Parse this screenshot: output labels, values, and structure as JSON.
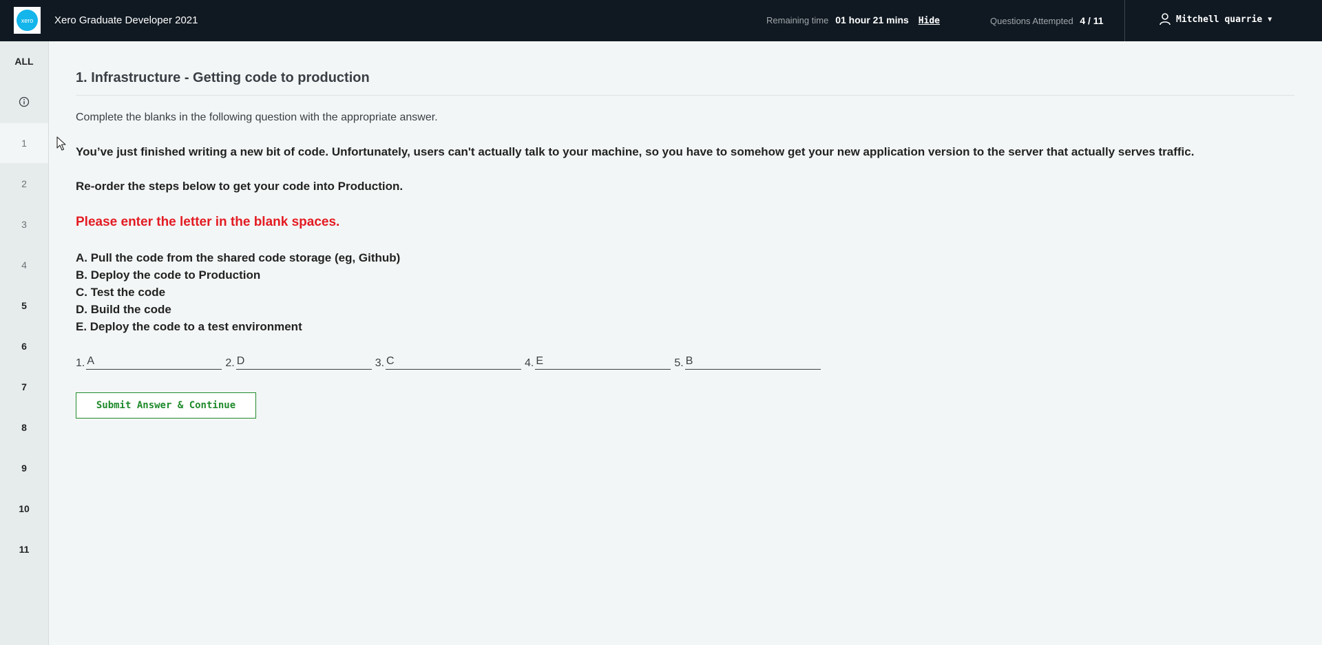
{
  "header": {
    "logo_text": "xero",
    "app_title": "Xero Graduate Developer 2021",
    "remaining_label": "Remaining time",
    "remaining_value": "01 hour 21 mins",
    "hide_label": "Hide",
    "attempted_label": "Questions Attempted",
    "attempted_value": "4 / 11",
    "user_name": "Mitchell quarrie"
  },
  "sidebar": {
    "all_label": "ALL",
    "info_icon": "info-icon",
    "items": [
      {
        "label": "1",
        "state": "active"
      },
      {
        "label": "2",
        "state": "attempted"
      },
      {
        "label": "3",
        "state": "attempted"
      },
      {
        "label": "4",
        "state": "attempted"
      },
      {
        "label": "5",
        "state": "unattempted"
      },
      {
        "label": "6",
        "state": "unattempted"
      },
      {
        "label": "7",
        "state": "unattempted"
      },
      {
        "label": "8",
        "state": "unattempted"
      },
      {
        "label": "9",
        "state": "unattempted"
      },
      {
        "label": "10",
        "state": "unattempted"
      },
      {
        "label": "11",
        "state": "unattempted"
      }
    ]
  },
  "question": {
    "title": "1. Infrastructure - Getting code to production",
    "instruction": "Complete the blanks in the following question with the appropriate answer.",
    "paragraph1": "You’ve just finished writing a new bit of code. Unfortunately, users can't actually talk to your machine, so you have to somehow get your new application version to the server that actually serves traffic.",
    "paragraph2": "Re-order the steps below to get your code into Production.",
    "warning": "Please enter the letter in the blank spaces.",
    "options": [
      "A. Pull the code from the shared code storage (eg, Github)",
      "B. Deploy the code to Production",
      "C. Test the code",
      "D. Build the code",
      "E. Deploy the code to a test environment"
    ],
    "answers": [
      {
        "num": "1.",
        "value": "A"
      },
      {
        "num": "2.",
        "value": "D"
      },
      {
        "num": "3.",
        "value": "C"
      },
      {
        "num": "4.",
        "value": "E"
      },
      {
        "num": "5.",
        "value": "B"
      }
    ],
    "submit_label": "Submit Answer & Continue"
  },
  "colors": {
    "topbar": "#101922",
    "warning": "#e31b23",
    "submit": "#1f8a2b",
    "logo": "#13b5ea"
  }
}
